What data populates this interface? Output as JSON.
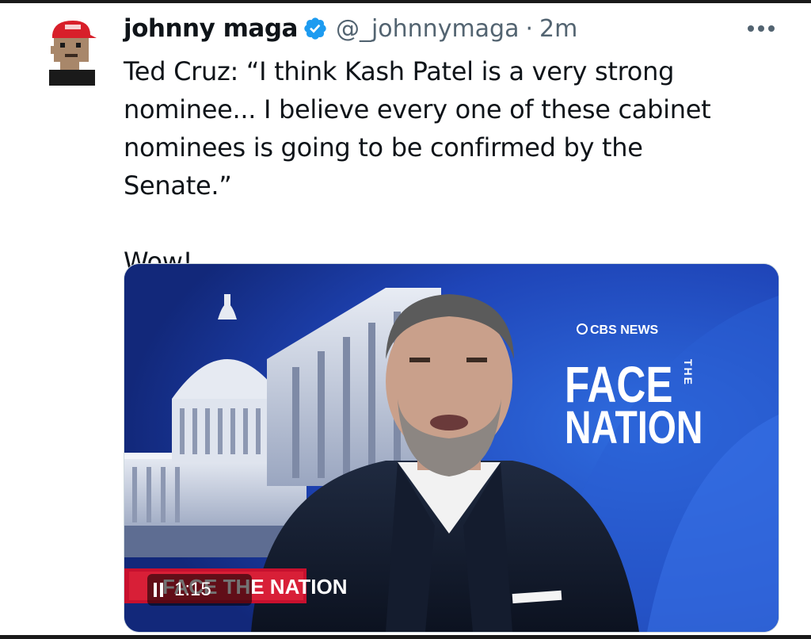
{
  "tweet": {
    "author": {
      "display_name": "johnny maga",
      "handle": "@_johnnymaga",
      "verified": true,
      "avatar_icon": "pixel-avatar-red-cap"
    },
    "separator": "·",
    "time": "2m",
    "more_icon": "more-dots-icon",
    "text_lines": [
      "Ted Cruz: “I think Kash Patel is a very strong",
      "nominee... I believe every one of these cabinet",
      "nominees is going to be confirmed by the Senate.”"
    ],
    "text_extra": "Wow!"
  },
  "media": {
    "type": "video",
    "network_logo": "CBS NEWS",
    "show_title_word1": "FACE",
    "show_title_small": "THE",
    "show_title_word2": "NATION",
    "lower_third": "FACE THE NATION",
    "duration": "1:15",
    "state_icon": "pause-icon",
    "colors": {
      "background_blue": "#1f3fa8",
      "lower_third_red": "#c8102e"
    }
  },
  "colors": {
    "verified_blue": "#1d9bf0",
    "secondary_text": "#536471",
    "primary_text": "#0f1419"
  }
}
